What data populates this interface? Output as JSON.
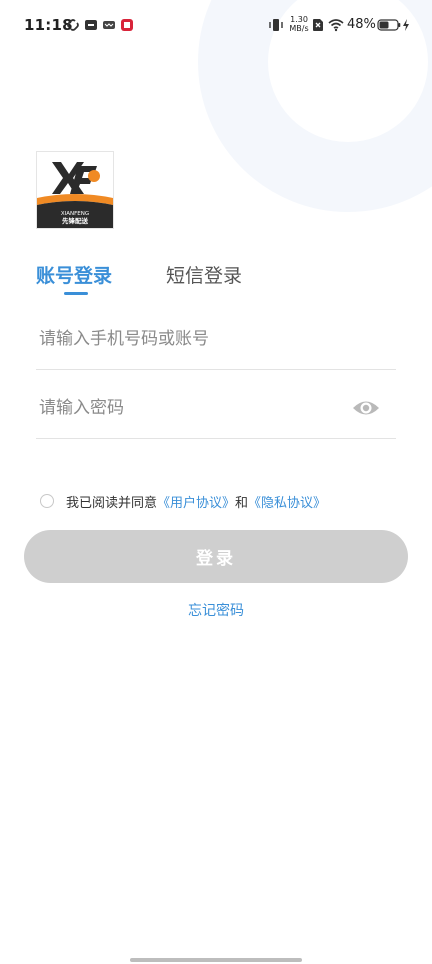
{
  "status_bar": {
    "time": "11:18",
    "network_speed_value": "1.30",
    "network_speed_unit": "MB/s",
    "battery_percent": "48%"
  },
  "logo": {
    "mark": "XF",
    "brand_en": "XIANFENG",
    "brand_cn": "先锋配送"
  },
  "tabs": {
    "account_login": "账号登录",
    "sms_login": "短信登录",
    "active": "account_login"
  },
  "form": {
    "phone_placeholder": "请输入手机号码或账号",
    "password_placeholder": "请输入密码"
  },
  "agreement": {
    "prefix": "我已阅读并同意",
    "user_agreement": "《用户协议》",
    "conjunction": "和",
    "privacy_policy": "《隐私协议》",
    "checked": false
  },
  "actions": {
    "login": "登录",
    "forgot_password": "忘记密码"
  },
  "colors": {
    "accent": "#3a8fd8",
    "button_disabled": "#cfcfcf",
    "logo_orange": "#f08a24",
    "logo_dark": "#2b2b2b"
  },
  "icons": {
    "password_visibility": "eye-icon"
  }
}
